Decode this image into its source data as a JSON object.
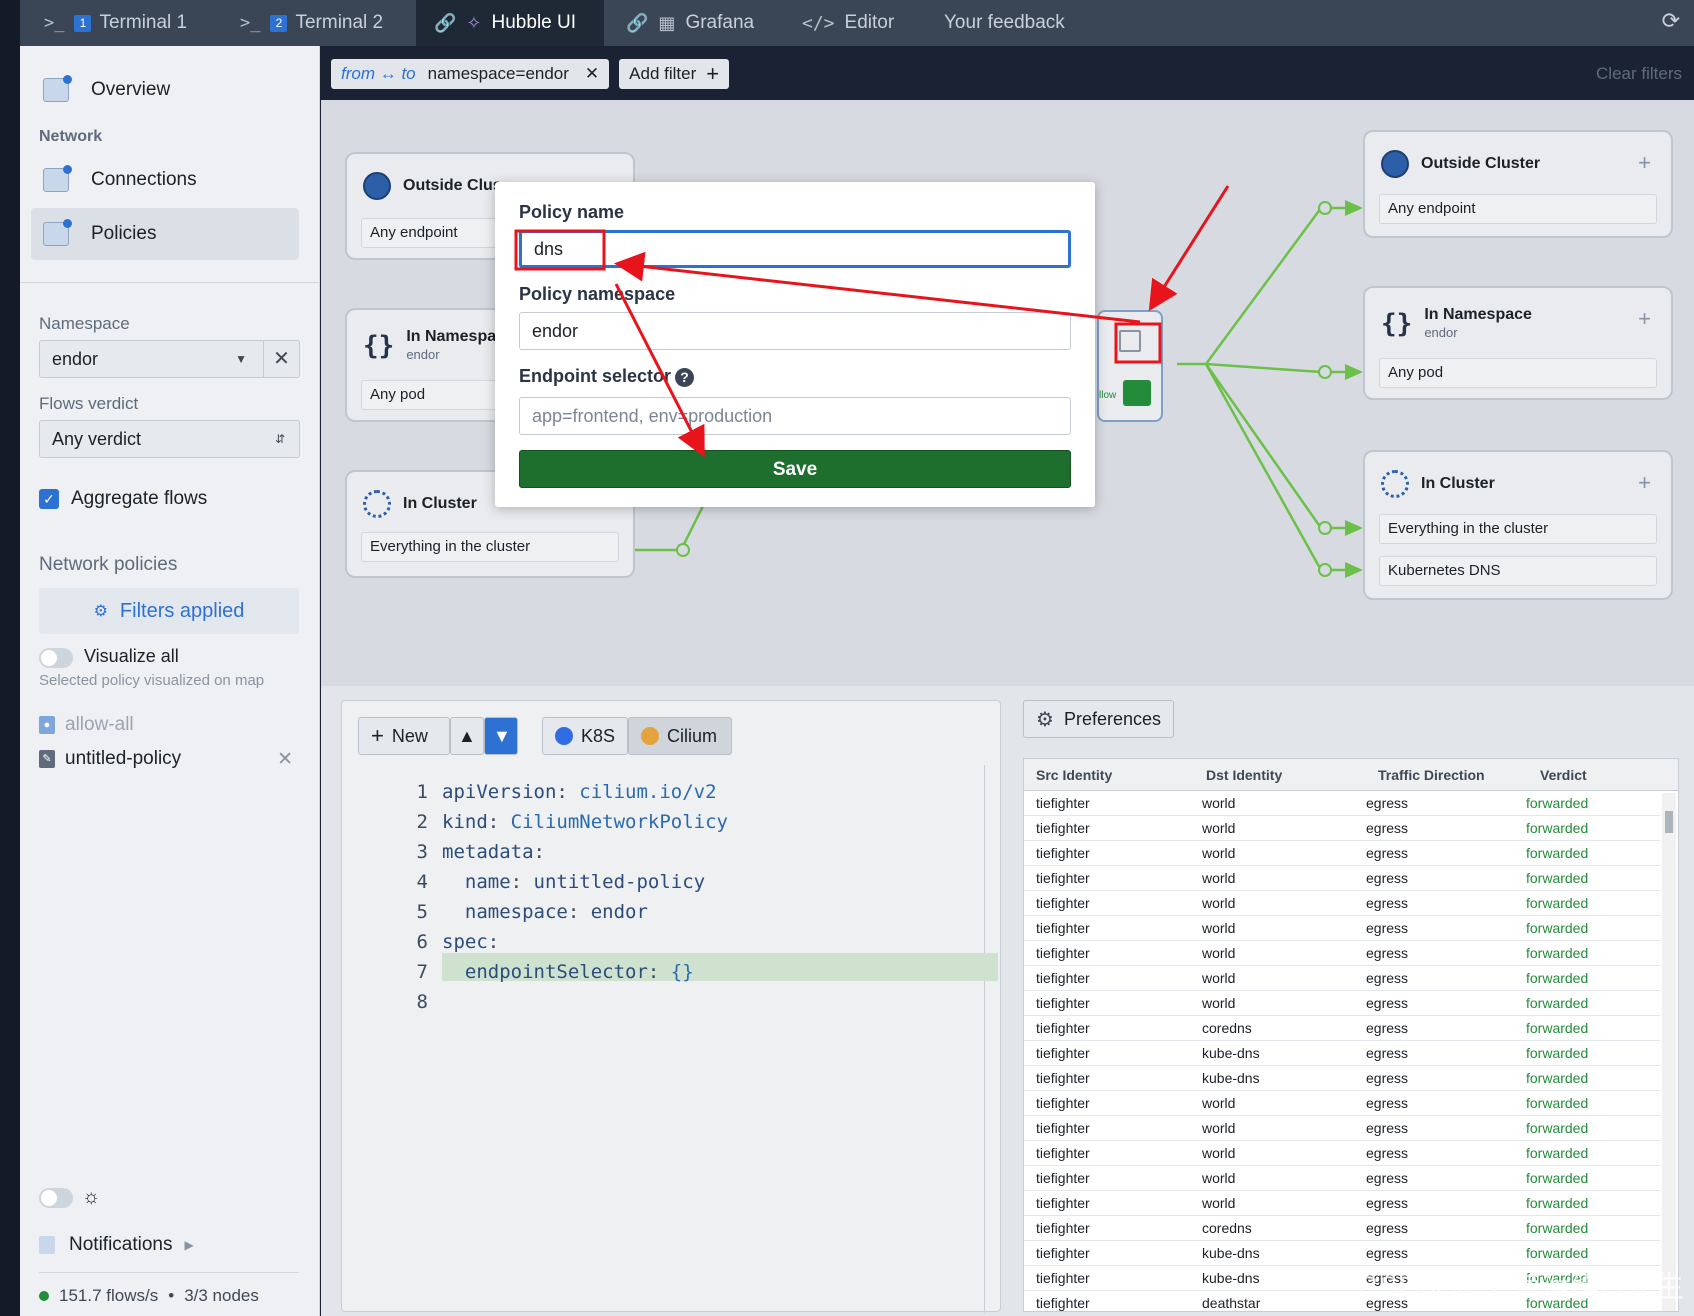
{
  "tabs": [
    {
      "label": "Terminal 1",
      "num": "1"
    },
    {
      "label": "Terminal 2",
      "num": "2"
    },
    {
      "label": "Hubble UI"
    },
    {
      "label": "Grafana"
    },
    {
      "label": "Editor"
    },
    {
      "label": "Your feedback"
    }
  ],
  "sidebar": {
    "overview": "Overview",
    "network_heading": "Network",
    "connections": "Connections",
    "policies": "Policies",
    "namespace_label": "Namespace",
    "namespace_value": "endor",
    "verdict_label": "Flows verdict",
    "verdict_value": "Any verdict",
    "aggregate": "Aggregate flows",
    "net_policies_label": "Network policies",
    "filters_applied": "Filters applied",
    "visualize_all": "Visualize all",
    "visualize_hint": "Selected policy visualized on map",
    "policy_allow_all": "allow-all",
    "policy_untitled": "untitled-policy",
    "notifications": "Notifications",
    "stats_rate": "151.7 flows/s",
    "stats_nodes": "3/3 nodes"
  },
  "filterbar": {
    "dir": "from ↔ to",
    "filter": "namespace=endor",
    "add": "Add filter",
    "clear": "Clear filters"
  },
  "map": {
    "left_cards": [
      {
        "title": "Outside Clus",
        "row1": "Any endpoint"
      },
      {
        "title": "In Namespa",
        "sub": "endor",
        "row1": "Any pod"
      },
      {
        "title": "In Cluster",
        "row1": "Everything in the cluster"
      }
    ],
    "right_cards": [
      {
        "title": "Outside Cluster",
        "row1": "Any endpoint"
      },
      {
        "title": "In Namespace",
        "sub": "endor",
        "row1": "Any pod"
      },
      {
        "title": "In Cluster",
        "row1": "Everything in the cluster",
        "row2": "Kubernetes DNS"
      }
    ],
    "edit_label": "llow"
  },
  "modal": {
    "name_label": "Policy name",
    "name_value": "dns",
    "ns_label": "Policy namespace",
    "ns_value": "endor",
    "selector_label": "Endpoint selector",
    "selector_placeholder": "app=frontend, env=production",
    "save": "Save"
  },
  "editor": {
    "new": "New",
    "k8s": "K8S",
    "cilium": "Cilium",
    "lines": [
      {
        "n": "1",
        "key": "apiVersion",
        "val": " cilium.io/v2"
      },
      {
        "n": "2",
        "key": "kind",
        "val": " CiliumNetworkPolicy"
      },
      {
        "n": "3",
        "key": "metadata",
        "val": ""
      },
      {
        "n": "4",
        "key": "  name",
        "val": " untitled-policy"
      },
      {
        "n": "5",
        "key": "  namespace",
        "val": " endor"
      },
      {
        "n": "6",
        "key": "spec",
        "val": ""
      },
      {
        "n": "7",
        "key": "  endpointSelector",
        "val": " {}"
      },
      {
        "n": "8",
        "key": "",
        "val": ""
      }
    ]
  },
  "table": {
    "preferences": "Preferences",
    "headers": [
      "Src Identity",
      "Dst Identity",
      "Traffic Direction",
      "Verdict"
    ],
    "rows": [
      [
        "tiefighter",
        "world",
        "egress",
        "forwarded"
      ],
      [
        "tiefighter",
        "world",
        "egress",
        "forwarded"
      ],
      [
        "tiefighter",
        "world",
        "egress",
        "forwarded"
      ],
      [
        "tiefighter",
        "world",
        "egress",
        "forwarded"
      ],
      [
        "tiefighter",
        "world",
        "egress",
        "forwarded"
      ],
      [
        "tiefighter",
        "world",
        "egress",
        "forwarded"
      ],
      [
        "tiefighter",
        "world",
        "egress",
        "forwarded"
      ],
      [
        "tiefighter",
        "world",
        "egress",
        "forwarded"
      ],
      [
        "tiefighter",
        "world",
        "egress",
        "forwarded"
      ],
      [
        "tiefighter",
        "coredns",
        "egress",
        "forwarded"
      ],
      [
        "tiefighter",
        "kube-dns",
        "egress",
        "forwarded"
      ],
      [
        "tiefighter",
        "kube-dns",
        "egress",
        "forwarded"
      ],
      [
        "tiefighter",
        "world",
        "egress",
        "forwarded"
      ],
      [
        "tiefighter",
        "world",
        "egress",
        "forwarded"
      ],
      [
        "tiefighter",
        "world",
        "egress",
        "forwarded"
      ],
      [
        "tiefighter",
        "world",
        "egress",
        "forwarded"
      ],
      [
        "tiefighter",
        "world",
        "egress",
        "forwarded"
      ],
      [
        "tiefighter",
        "coredns",
        "egress",
        "forwarded"
      ],
      [
        "tiefighter",
        "kube-dns",
        "egress",
        "forwarded"
      ],
      [
        "tiefighter",
        "kube-dns",
        "egress",
        "forwarded"
      ],
      [
        "tiefighter",
        "deathstar",
        "egress",
        "forwarded"
      ]
    ]
  },
  "watermark": "CSDN @上海运维Q先生",
  "colors": {
    "accent": "#2d72d2",
    "save": "#1e6e2e",
    "forwarded": "#238c3a",
    "flow": "#6cc04a",
    "annotation": "#e8141c"
  }
}
